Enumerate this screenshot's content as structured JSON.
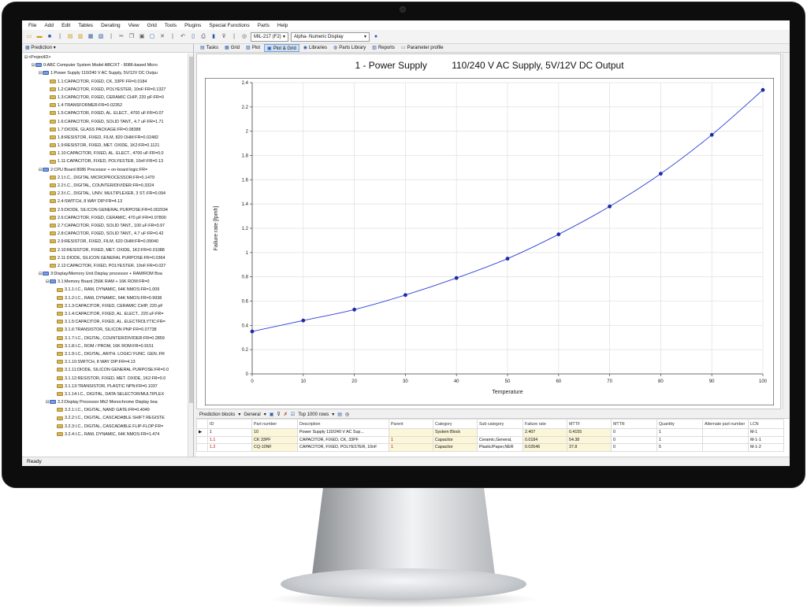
{
  "menu": [
    "File",
    "Add",
    "Edit",
    "Tables",
    "Derating",
    "View",
    "Grid",
    "Tools",
    "Plugins",
    "Special Functions",
    "Parts",
    "Help"
  ],
  "toolbar": {
    "standard": "MIL-217 (F2)",
    "display_mode": "Alpha- Numeric Display"
  },
  "left_pane": {
    "header": "Prediction"
  },
  "tree": [
    {
      "indent": 0,
      "exp": "⊟",
      "icon": "none",
      "text": "<ProjectID>"
    },
    {
      "indent": 1,
      "exp": "⊟",
      "icon": "b",
      "text": "0:ABC Computer System Model ABC/XT - 8086-based Micro"
    },
    {
      "indent": 2,
      "exp": "⊟",
      "icon": "b",
      "text": "1:Power Supply       110/240 V AC Supply, 5V/12V DC Outpu"
    },
    {
      "indent": 3,
      "exp": "",
      "icon": "y",
      "text": "1.1:CAPACITOR, FIXED, CK, 33PF:FR=0.0184"
    },
    {
      "indent": 3,
      "exp": "",
      "icon": "y",
      "text": "1.2:CAPACITOR, FIXED, POLYESTER, 10nF:FR=0.1327"
    },
    {
      "indent": 3,
      "exp": "",
      "icon": "y",
      "text": "1.3:CAPACITOR, FIXED, CERAMIC CHIP, 220 pF:FR=0"
    },
    {
      "indent": 3,
      "exp": "",
      "icon": "y",
      "text": "1.4:TRANSFORMER:FR=0.02352"
    },
    {
      "indent": 3,
      "exp": "",
      "icon": "y",
      "text": "1.5:CAPACITOR, FIXED, AL. ELECT., 4700 uF:FR=0.07"
    },
    {
      "indent": 3,
      "exp": "",
      "icon": "y",
      "text": "1.6:CAPACITOR, FIXED, SOLID TANT., 4.7 uF:FR=1.71"
    },
    {
      "indent": 3,
      "exp": "",
      "icon": "y",
      "text": "1.7:DIODE, GLASS PACKAGE:FR=0.08388"
    },
    {
      "indent": 3,
      "exp": "",
      "icon": "y",
      "text": "1.8:RESISTOR, FIXED, FILM, 820 OHM:FR=0.02482"
    },
    {
      "indent": 3,
      "exp": "",
      "icon": "y",
      "text": "1.9:RESISTOR, FIXED, MET. OXIDE, 1K2:FR=0.1121"
    },
    {
      "indent": 3,
      "exp": "",
      "icon": "y",
      "text": "1.10:CAPACITOR, FIXED, AL. ELECT., 4700 uF:FR=0.0"
    },
    {
      "indent": 3,
      "exp": "",
      "icon": "y",
      "text": "1.11:CAPACITOR, FIXED, POLYESTER, 10nF:FR=0.13"
    },
    {
      "indent": 2,
      "exp": "⊟",
      "icon": "b",
      "text": "2:CPU Board          8086 Processor + on-board logic:FR="
    },
    {
      "indent": 3,
      "exp": "",
      "icon": "y",
      "text": "2.1:I.C., DIGITAL MICROPROCESSOR:FR=0.1479"
    },
    {
      "indent": 3,
      "exp": "",
      "icon": "y",
      "text": "2.2:I.C., DIGITAL, COUNTER/DIVIDER:FR=0.3324"
    },
    {
      "indent": 3,
      "exp": "",
      "icon": "y",
      "text": "2.3:I.C., DIGITAL, UNIV. MULTIPLEXER, 3 ST.:FR=0.094"
    },
    {
      "indent": 3,
      "exp": "",
      "icon": "y",
      "text": "2.4:SWITCH, 8 WAY DIP:FR=4.13"
    },
    {
      "indent": 3,
      "exp": "",
      "icon": "y",
      "text": "2.5:DIODE, SILICON GENERAL PURPOSE:FR=0.002034"
    },
    {
      "indent": 3,
      "exp": "",
      "icon": "y",
      "text": "2.6:CAPACITOR, FIXED, CERAMIC, 470 pF:FR=0.07800"
    },
    {
      "indent": 3,
      "exp": "",
      "icon": "y",
      "text": "2.7:CAPACITOR, FIXED, SOLID TANT., 100 uF:FR=0.97"
    },
    {
      "indent": 3,
      "exp": "",
      "icon": "y",
      "text": "2.8:CAPACITOR, FIXED, SOLID TANT., 4.7 uF:FR=0.42"
    },
    {
      "indent": 3,
      "exp": "",
      "icon": "y",
      "text": "2.9:RESISTOR, FIXED, FILM, 620 OHM:FR=0.09040"
    },
    {
      "indent": 3,
      "exp": "",
      "icon": "y",
      "text": "2.10:RESISTOR, FIXED, MET. OXIDE, 1K2:FR=0.01088"
    },
    {
      "indent": 3,
      "exp": "",
      "icon": "y",
      "text": "2.11:DIODE, SILICON GENERAL PURPOSE:FR=0.0364"
    },
    {
      "indent": 3,
      "exp": "",
      "icon": "y",
      "text": "2.12:CAPACITOR, FIXED, POLYESTER, 10nF:FR=0.027"
    },
    {
      "indent": 2,
      "exp": "⊟",
      "icon": "b",
      "text": "3:Display/Memory Unit Display processor + RAM/ROM Boa"
    },
    {
      "indent": 3,
      "exp": "⊟",
      "icon": "b",
      "text": "3.1:Memory Board       256K RAM + 16K ROM:FR=0"
    },
    {
      "indent": 4,
      "exp": "",
      "icon": "y",
      "text": "3.1.1:I.C., RAM, DYNAMIC, 64K NMOS:FR=1.009"
    },
    {
      "indent": 4,
      "exp": "",
      "icon": "y",
      "text": "3.1.2:I.C., RAM, DYNAMIC, 64K NMOS:FR=0.9938"
    },
    {
      "indent": 4,
      "exp": "",
      "icon": "y",
      "text": "3.1.3:CAPACITOR, FIXED, CERAMIC CHIP, 220 pF"
    },
    {
      "indent": 4,
      "exp": "",
      "icon": "y",
      "text": "3.1.4:CAPACITOR, FIXED, AL. ELECT., 220 uF:FR="
    },
    {
      "indent": 4,
      "exp": "",
      "icon": "y",
      "text": "3.1.5:CAPACITOR, FIXED, AL. ELECTROLYTIC:FR="
    },
    {
      "indent": 4,
      "exp": "",
      "icon": "y",
      "text": "3.1.6:TRANSISTOR, SILICON PNP:FR=0.07738"
    },
    {
      "indent": 4,
      "exp": "",
      "icon": "y",
      "text": "3.1.7:I.C., DIGITAL, COUNTER/DIVIDER:FR=0.2859"
    },
    {
      "indent": 4,
      "exp": "",
      "icon": "y",
      "text": "3.1.8:I.C., ROM / PROM, 16K ROM:FR=0.9151"
    },
    {
      "indent": 4,
      "exp": "",
      "icon": "y",
      "text": "3.1.9:I.C., DIGITAL, ARITH. LOGIC/ FUNC. GEN.:FR"
    },
    {
      "indent": 4,
      "exp": "",
      "icon": "y",
      "text": "3.1.10:SWITCH, 8 WAY DIP:FR=4.13"
    },
    {
      "indent": 4,
      "exp": "",
      "icon": "y",
      "text": "3.1.11:DIODE, SILICON GENERAL PURPOSE:FR=0.0"
    },
    {
      "indent": 4,
      "exp": "",
      "icon": "y",
      "text": "3.1.12:RESISTOR, FIXED, MET. OXIDE, 1K2:FR=0.0"
    },
    {
      "indent": 4,
      "exp": "",
      "icon": "y",
      "text": "3.1.13:TRANSISTOR, PLASTIC NPN:FR=0.1037"
    },
    {
      "indent": 4,
      "exp": "",
      "icon": "y",
      "text": "3.1.14:I.C., DIGITAL, DATA SELECTOR/MULTIPLEX"
    },
    {
      "indent": 3,
      "exp": "⊟",
      "icon": "b",
      "text": "3.2:Display Processor   Mk2 Monochrome Display boa"
    },
    {
      "indent": 4,
      "exp": "",
      "icon": "y",
      "text": "3.2.1:I.C., DIGITAL, NAND GATE:FR=0.4049"
    },
    {
      "indent": 4,
      "exp": "",
      "icon": "y",
      "text": "3.2.2:I.C., DIGITAL, CASCADABLE SHIFT REGISTE"
    },
    {
      "indent": 4,
      "exp": "",
      "icon": "y",
      "text": "3.2.3:I.C., DIGITAL, CASCADABLE FLIP-FLOP:FR="
    },
    {
      "indent": 4,
      "exp": "",
      "icon": "y",
      "text": "3.2.4:I.C., RAM, DYNAMIC, 64K NMOS:FR=1.474"
    }
  ],
  "tabs": [
    "Tasks",
    "Grid",
    "Plot",
    "Plot & Grid",
    "Libraries",
    "Parts Library",
    "Reports",
    "Parameter profile"
  ],
  "active_tab": "Plot & Grid",
  "plot": {
    "title_left": "1 - Power Supply",
    "title_right": "110/240 V AC Supply, 5V/12V DC Output"
  },
  "chart_data": {
    "type": "line",
    "x": [
      0,
      10,
      20,
      30,
      40,
      50,
      60,
      70,
      80,
      90,
      100
    ],
    "values": [
      0.35,
      0.44,
      0.53,
      0.65,
      0.79,
      0.95,
      1.15,
      1.38,
      1.65,
      1.97,
      2.34
    ],
    "xlabel": "Temperature",
    "ylabel": "Failure rate [fpmh]",
    "xlim": [
      0,
      100
    ],
    "ylim": [
      0,
      2.4
    ],
    "xticks": [
      0,
      10,
      20,
      30,
      40,
      50,
      60,
      70,
      80,
      90,
      100
    ],
    "yticks": [
      0,
      0.2,
      0.4,
      0.6,
      0.8,
      1,
      1.2,
      1.4,
      1.6,
      1.8,
      2,
      2.2,
      2.4
    ],
    "grid": true,
    "line_color": "#2b3fd6",
    "marker_color": "#1b2aa8"
  },
  "grid_toolbar": {
    "blocks": "Prediction blocks",
    "view": "General",
    "rows": "Top 1000 rows"
  },
  "grid": {
    "columns": [
      "",
      "ID",
      "Part number",
      "Description",
      "Parent",
      "Category",
      "Sub category",
      "Failure rate",
      "MTTF",
      "MTTR",
      "Quantity",
      "Alternate part number",
      "LCN"
    ],
    "rows": [
      {
        "marker": "▶",
        "id": "1",
        "part": "10",
        "desc": "Power Supply       110/240 V AC Sup...",
        "parent": "",
        "cat": "System Block",
        "sub": "",
        "fr": "2.407",
        "mttf": "0.4155",
        "mttr": "0",
        "qty": "1",
        "alt": "",
        "lcn": "M-1"
      },
      {
        "marker": "",
        "id": "1.1",
        "part": "CK 33PF",
        "desc": "CAPACITOR, FIXED, CK, 33PF",
        "parent": "1",
        "cat": "Capacitor",
        "sub": "Ceramic,General,",
        "fr": "0.0184",
        "mttf": "54.38",
        "mttr": "0",
        "qty": "1",
        "alt": "",
        "lcn": "M-1-1"
      },
      {
        "marker": "",
        "id": "1.2",
        "part": "CQ-10NF",
        "desc": "CAPACITOR, FIXED, POLYESTER, 10nF",
        "parent": "1",
        "cat": "Capacitor",
        "sub": "Plastic/Paper,NER",
        "fr": "0.02646",
        "mttf": "37.8",
        "mttr": "0",
        "qty": "5",
        "alt": "",
        "lcn": "M-1-2"
      }
    ]
  },
  "status": "Ready"
}
